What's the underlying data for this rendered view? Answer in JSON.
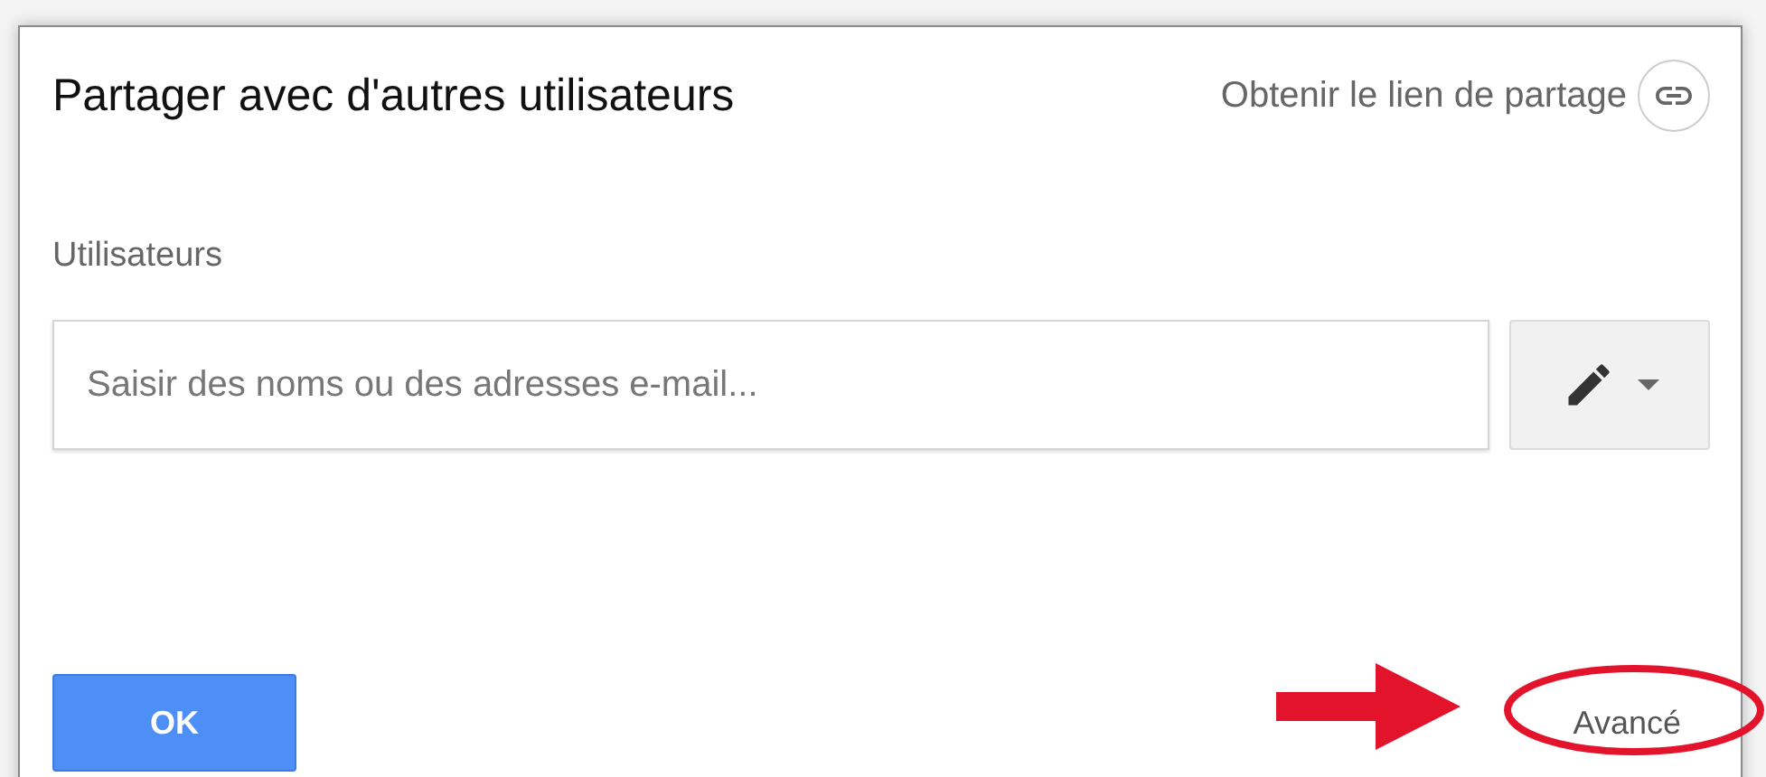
{
  "dialog": {
    "title": "Partager avec d'autres utilisateurs",
    "link_action": "Obtenir le lien de partage"
  },
  "users": {
    "label": "Utilisateurs",
    "placeholder": "Saisir des noms ou des adresses e-mail..."
  },
  "footer": {
    "ok": "OK",
    "advanced": "Avancé"
  }
}
